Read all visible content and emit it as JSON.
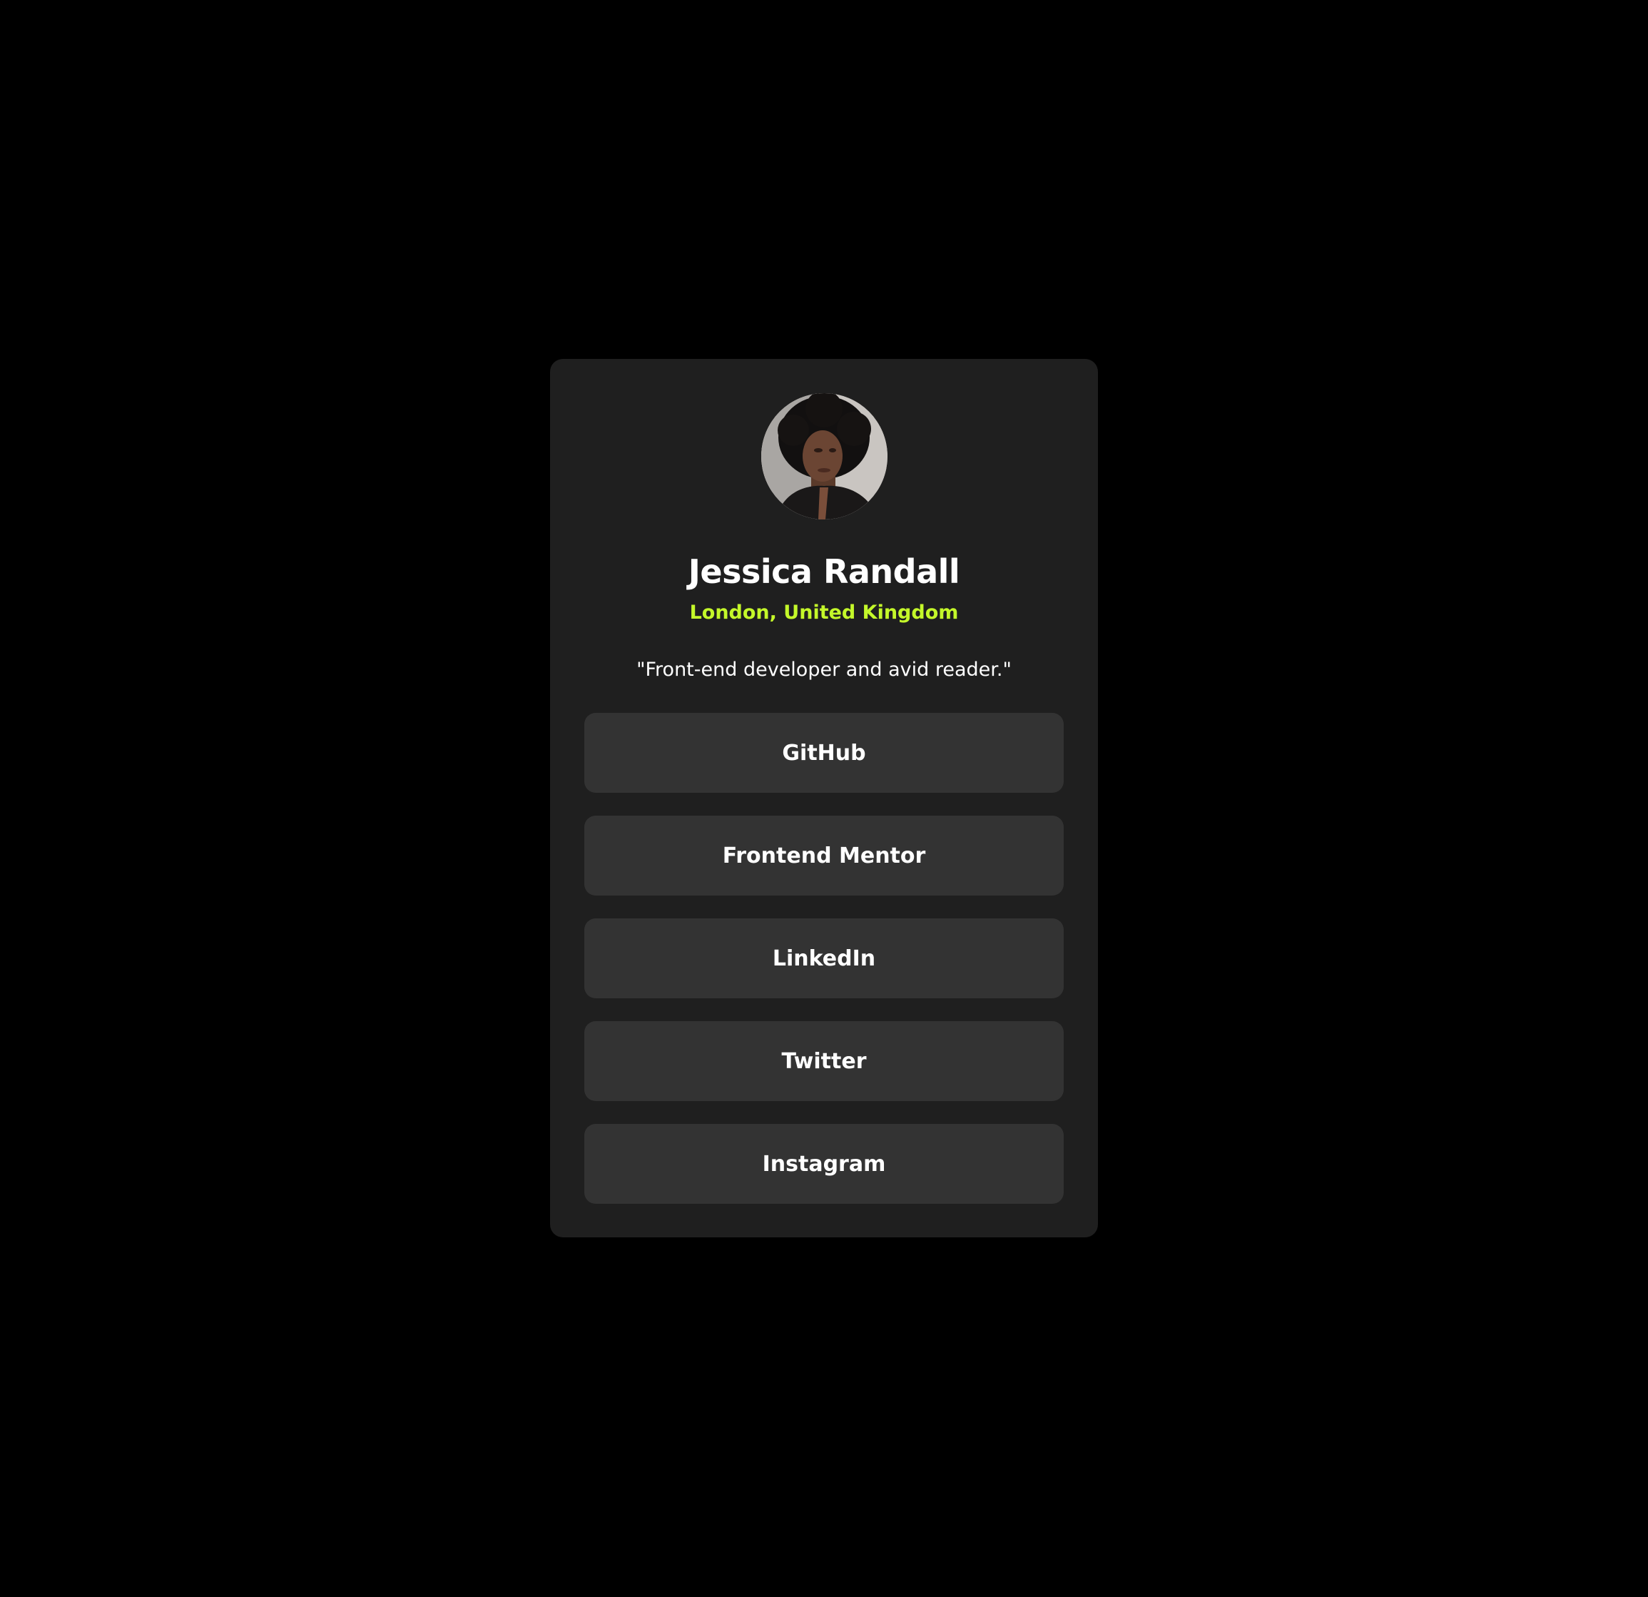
{
  "profile": {
    "name": "Jessica Randall",
    "location": "London, United Kingdom",
    "bio": "\"Front-end developer and avid reader.\"",
    "avatar_icon": "profile-photo"
  },
  "links": [
    {
      "label": "GitHub"
    },
    {
      "label": "Frontend Mentor"
    },
    {
      "label": "LinkedIn"
    },
    {
      "label": "Twitter"
    },
    {
      "label": "Instagram"
    }
  ],
  "colors": {
    "page_background": "#000000",
    "card_background": "#1f1f1f",
    "button_background": "#333333",
    "accent": "#c4f82a",
    "text": "#ffffff"
  }
}
